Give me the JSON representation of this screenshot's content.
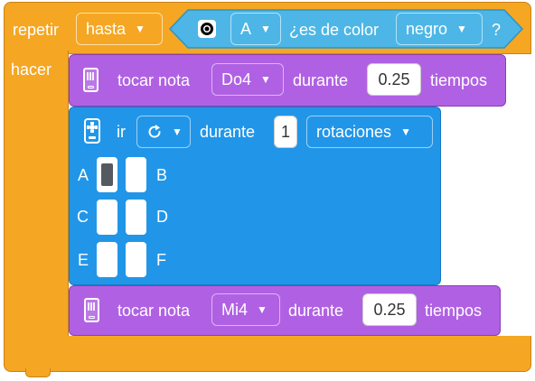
{
  "repeat_block": {
    "repeat_label": "repetir",
    "mode_dropdown": "hasta",
    "do_label": "hacer"
  },
  "condition": {
    "port_dropdown": "A",
    "question_text": "¿es de color",
    "color_dropdown": "negro",
    "question_mark": "?"
  },
  "play_note_1": {
    "prefix": "tocar nota",
    "note_dropdown": "Do4",
    "middle": "durante",
    "beats_value": "0.25",
    "suffix": "tiempos"
  },
  "move_block": {
    "go_label": "ir",
    "direction_icon": "rotate-clockwise-icon",
    "during_label": "durante",
    "amount_value": "1",
    "unit_dropdown": "rotaciones",
    "ports": [
      {
        "label": "A",
        "selected": true
      },
      {
        "label": "B",
        "selected": false
      },
      {
        "label": "C",
        "selected": false
      },
      {
        "label": "D",
        "selected": false
      },
      {
        "label": "E",
        "selected": false
      },
      {
        "label": "F",
        "selected": false
      }
    ]
  },
  "play_note_2": {
    "prefix": "tocar nota",
    "note_dropdown": "Mi4",
    "middle": "durante",
    "beats_value": "0.25",
    "suffix": "tiempos"
  },
  "colors": {
    "control_orange": "#F5A623",
    "sound_purple": "#B061E3",
    "motor_blue": "#2196E8",
    "sensor_cyan": "#4DB6E6"
  }
}
